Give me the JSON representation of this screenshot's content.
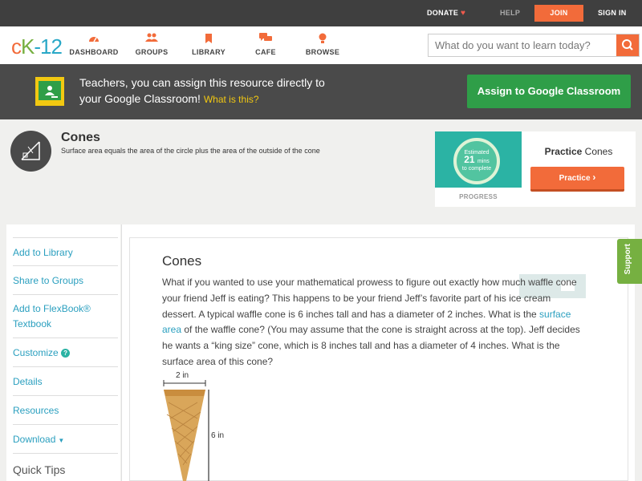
{
  "topbar": {
    "donate": "DONATE",
    "help": "HELP",
    "join": "JOIN",
    "signin": "SIGN IN"
  },
  "logo": {
    "c": "c",
    "k": "K",
    "n": "-12"
  },
  "nav": {
    "items": [
      {
        "label": "DASHBOARD",
        "icon": "dashboard-icon"
      },
      {
        "label": "GROUPS",
        "icon": "groups-icon"
      },
      {
        "label": "LIBRARY",
        "icon": "library-icon"
      },
      {
        "label": "CAFE",
        "icon": "cafe-icon"
      },
      {
        "label": "BROWSE",
        "icon": "browse-icon"
      }
    ],
    "search_placeholder": "What do you want to learn today?"
  },
  "banner": {
    "line1": "Teachers, you can assign this resource directly to",
    "line2": "your Google Classroom!",
    "what": "What is this?",
    "assign": "Assign to Google Classroom"
  },
  "header": {
    "title": "Cones",
    "subtitle": "Surface area equals the area of the circle plus the area of the outside of the cone"
  },
  "practice": {
    "estimated": "Estimated",
    "mins": "21",
    "mins_label": "mins",
    "to_complete": "to complete",
    "progress": "PROGRESS",
    "title_bold": "Practice",
    "title_rest": " Cones",
    "button": "Practice"
  },
  "sidebar": {
    "items": [
      "Add to Library",
      "Share to Groups",
      "Add to FlexBook®",
      "Textbook",
      "Customize",
      "Details",
      "Resources",
      "Download"
    ],
    "quick_tips": "Quick Tips"
  },
  "article": {
    "title": "Cones",
    "p1": "What if you wanted to use your mathematical prowess to figure out exactly how much waffle cone your friend Jeff is eating? This happens to be your friend Jeff’s favorite part of his ice cream dessert. A typical waffle cone is 6 inches tall and has a diameter of 2 inches. What is the ",
    "link": "surface area",
    "p2": " of the waffle cone? (You may assume that the cone is straight across at the top). Jeff decides he wants a “king size” cone, which is 8 inches tall and has a diameter of 4 inches. What is the surface area of this cone?",
    "fig_width": "2 in",
    "fig_height": "6 in"
  },
  "support": "Support",
  "colors": {
    "accent_orange": "#f26b3a",
    "google_green": "#2f9e48",
    "link_blue": "#2a9fbf",
    "support_green": "#76b041"
  }
}
